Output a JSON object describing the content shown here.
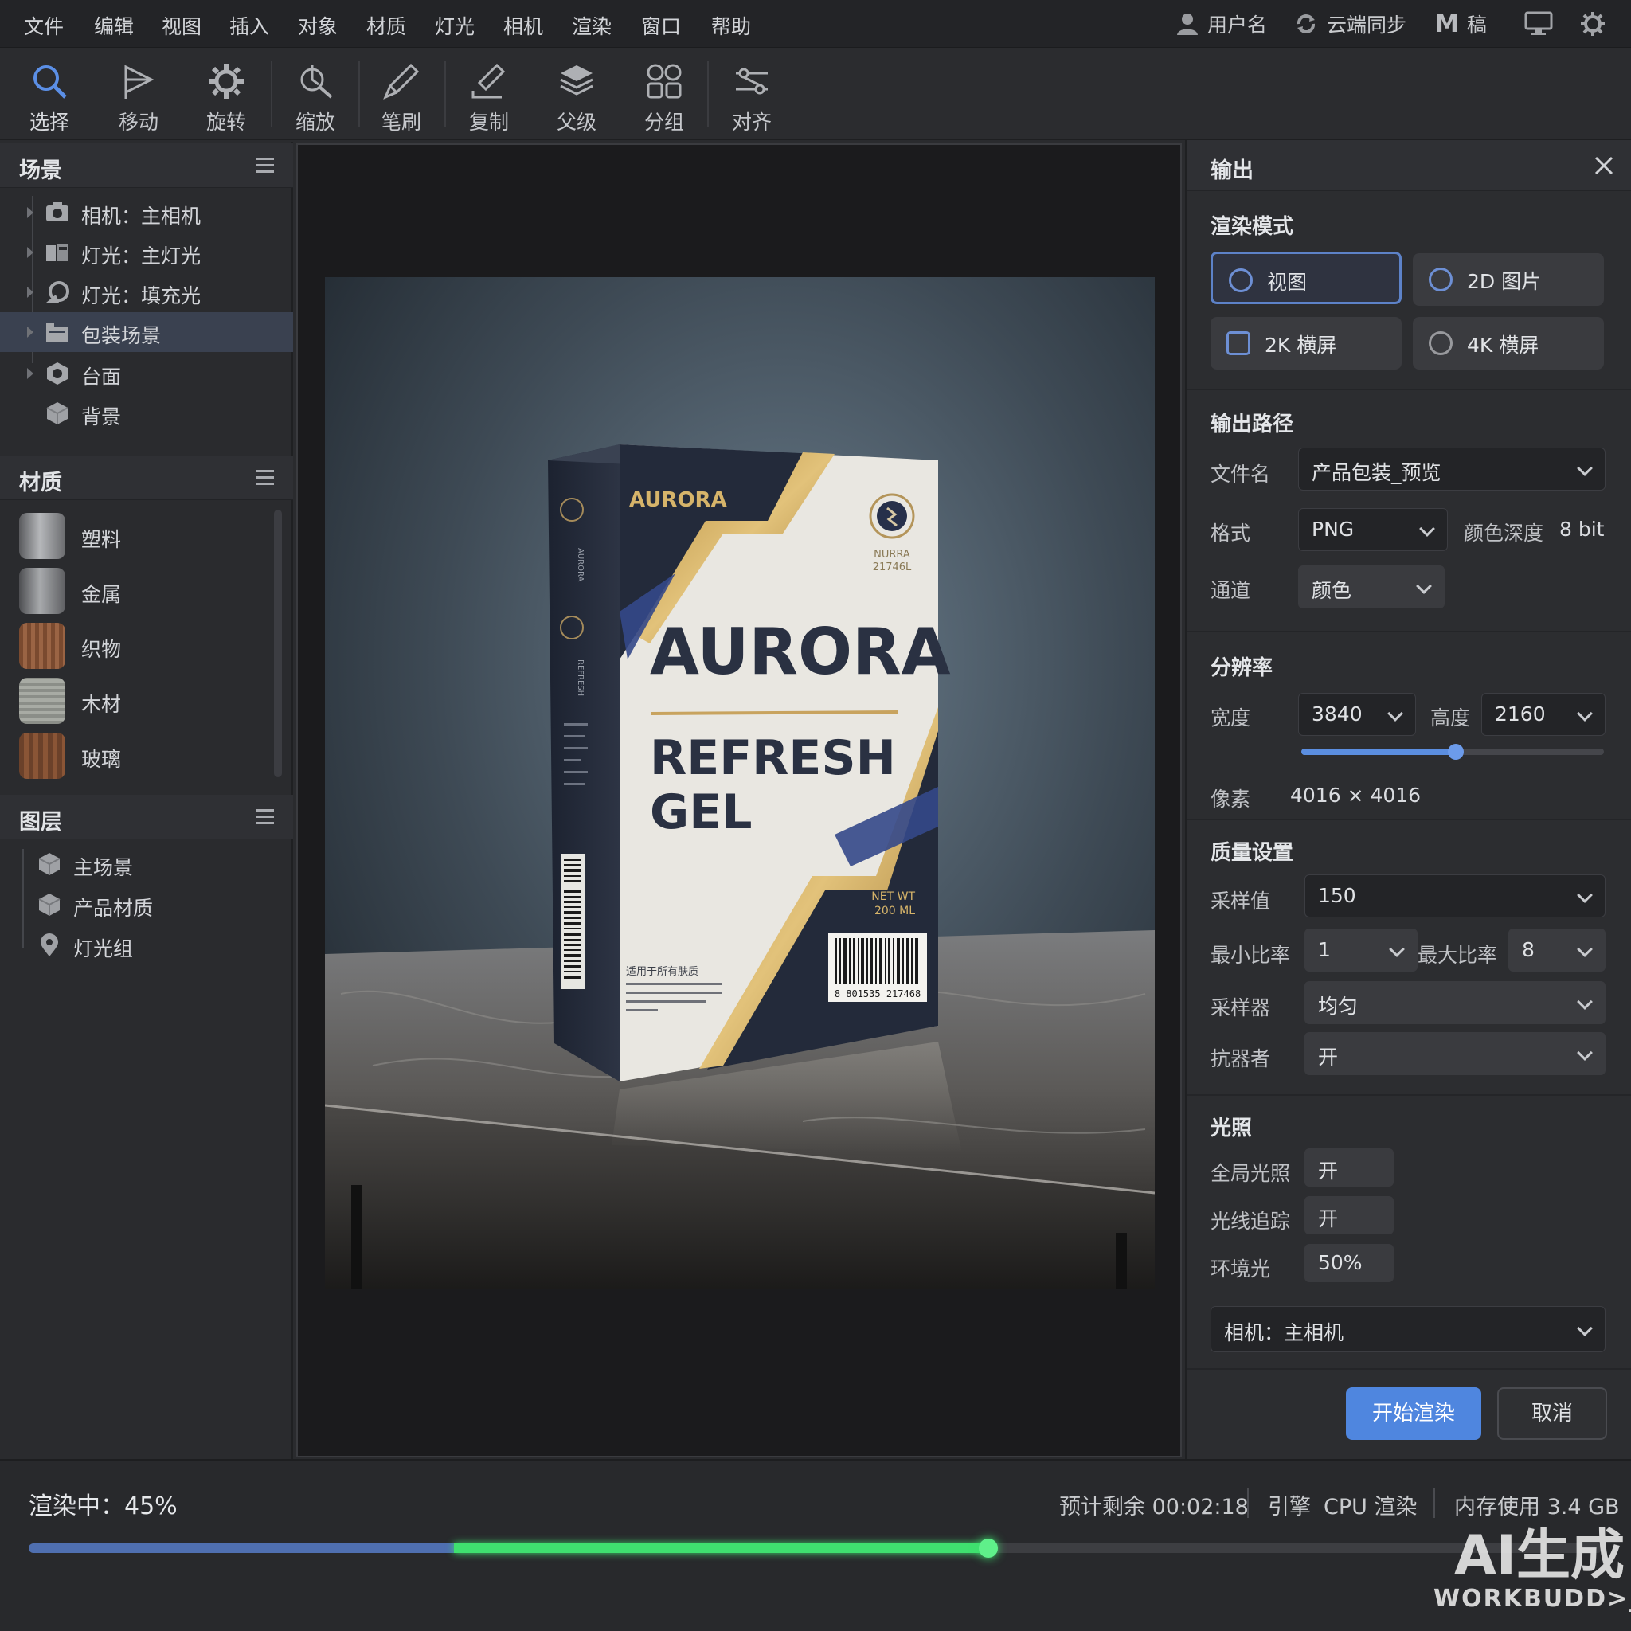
{
  "menu": [
    "文件",
    "编辑",
    "视图",
    "插入",
    "对象",
    "材质",
    "灯光",
    "相机",
    "渲染",
    "窗口",
    "帮助"
  ],
  "account": {
    "user": "用户名",
    "sync": "云端同步",
    "logo_letter": "M",
    "draft": "稿"
  },
  "tools": [
    {
      "label": "选择",
      "icon": "search-icon"
    },
    {
      "label": "移动",
      "icon": "move-icon"
    },
    {
      "label": "旋转",
      "icon": "gear-icon"
    },
    {
      "label": "缩放",
      "icon": "scale-icon"
    },
    {
      "label": "笔刷",
      "icon": "brush-icon"
    },
    {
      "label": "复制",
      "icon": "duplicate-icon"
    },
    {
      "label": "父级",
      "icon": "layers-icon"
    },
    {
      "label": "分组",
      "icon": "group-icon"
    },
    {
      "label": "对齐",
      "icon": "align-icon"
    }
  ],
  "scene": {
    "title": "场景",
    "items": [
      "相机：主相机",
      "灯光：主灯光",
      "灯光：填充光",
      "包装场景",
      "台面",
      "背景"
    ],
    "selected_index": 3
  },
  "materials": {
    "title": "材质",
    "items": [
      {
        "label": "塑料",
        "color": "#8a8b8f"
      },
      {
        "label": "金属",
        "color": "#7d7f83"
      },
      {
        "label": "织物",
        "color": "#8b5a3c"
      },
      {
        "label": "木材",
        "color": "#9a9d97"
      },
      {
        "label": "玻璃",
        "color": "#7a4e34"
      }
    ]
  },
  "layers": {
    "title": "图层",
    "items": [
      "主场景",
      "产品材质",
      "灯光组"
    ]
  },
  "product": {
    "brand_small": "AURORA",
    "brand_big": "AURORA",
    "line1": "REFRESH",
    "line2": "GEL",
    "seal_text1": "NURRA",
    "seal_text2": "21746L",
    "net_wt": "NET WT",
    "volume": "200 ML",
    "barcode_text": "8 801535 217468",
    "note_cn": "适用于所有肤质",
    "side_brand1": "AURORA",
    "side_brand2": "REFRESH"
  },
  "output": {
    "title": "输出",
    "render_mode_title": "渲染模式",
    "modes": [
      {
        "label": "视图",
        "selected": true
      },
      {
        "label": "2D 图片",
        "selected": false
      },
      {
        "label": "2K 横屏",
        "selected": false
      },
      {
        "label": "4K 横屏",
        "selected": false
      }
    ],
    "path_title": "输出路径",
    "filename_label": "文件名",
    "filename_value": "产品包装_预览",
    "format_label": "格式",
    "format_value": "PNG",
    "depth_label": "颜色深度",
    "depth_value": "8 bit",
    "channel_label": "通道",
    "channel_value": "颜色",
    "resolution_title": "分辨率",
    "width_label": "宽度",
    "width_value": "3840",
    "height_label": "高度",
    "height_value": "2160",
    "resolution_slider": 0.51,
    "pixels_label": "像素",
    "pixels_value": "4016 × 4016",
    "quality_title": "质量设置",
    "samples_label": "采样值",
    "samples_value": "150",
    "min_rate_label": "最小比率",
    "min_rate_value": "1",
    "max_rate_label": "最大比率",
    "max_rate_value": "8",
    "sampler_label": "采样器",
    "sampler_value": "均匀",
    "aa_label": "抗器者",
    "aa_value": "开",
    "lighting_title": "光照",
    "gi_label": "全局光照",
    "gi_value": "开",
    "rt_label": "光线追踪",
    "rt_value": "开",
    "ambient_label": "环境光",
    "ambient_value": "50%",
    "camera_value": "相机：主相机",
    "start_button": "开始渲染",
    "cancel_button": "取消"
  },
  "status": {
    "rendering_label": "渲染中：45%",
    "progress": 0.45,
    "eta": "预计剩余 00:02:18",
    "engine_label": "引擎",
    "engine_value": "CPU 渲染",
    "memory": "内存使用 3.4 GB"
  },
  "watermark": {
    "line1": "AI生成",
    "line2": "WORKBUDD>_"
  },
  "colors": {
    "accent": "#4f86df",
    "progress_green": "#3fe06f",
    "progress_blue": "#4f6fb0"
  }
}
